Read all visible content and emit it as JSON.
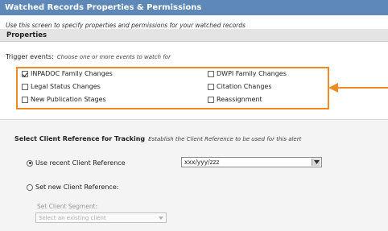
{
  "window": {
    "title": "Watched Records Properties & Permissions",
    "instructions": "Use this screen to specify properties and permissions for your watched records"
  },
  "properties": {
    "header": "Properties",
    "trigger_label": "Trigger events:",
    "trigger_hint": "Choose one or more events to watch for",
    "events": [
      {
        "label": "INPADOC Family Changes",
        "checked": true
      },
      {
        "label": "Legal Status Changes",
        "checked": false
      },
      {
        "label": "New Publication Stages",
        "checked": false
      },
      {
        "label": "DWPI Family Changes",
        "checked": false
      },
      {
        "label": "Citation Changes",
        "checked": false
      },
      {
        "label": "Reassignment",
        "checked": false
      }
    ]
  },
  "client_reference": {
    "title": "Select Client Reference for Tracking",
    "hint": "Establish the Client Reference to be used for this alert",
    "options": [
      {
        "label": "Use recent Client Reference",
        "selected": true
      },
      {
        "label": "Set new Client Reference:",
        "selected": false
      }
    ],
    "recent_value": "xxx/yyy/zzz",
    "segment_label": "Set Client Segment:",
    "segment_placeholder": "Select an existing client"
  },
  "colors": {
    "title_bar": "#5e88b8",
    "highlight": "#f08a22"
  },
  "icons": {
    "dropdown": "chevron-down-icon",
    "callout": "arrow-left-icon"
  }
}
